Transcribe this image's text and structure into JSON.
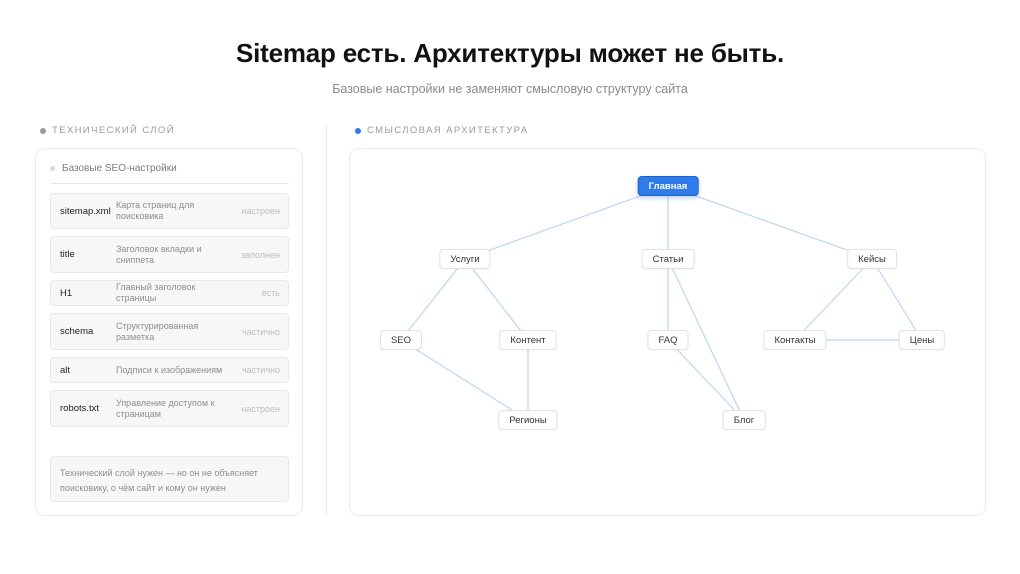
{
  "header": {
    "title": "Sitemap есть. Архитектуры может не быть.",
    "subtitle": "Базовые настройки не заменяют смысловую структуру сайта"
  },
  "left": {
    "section_label": "ТЕХНИЧЕСКИЙ СЛОЙ",
    "card_title": "Базовые SEO-настройки",
    "rows": [
      {
        "key": "sitemap.xml",
        "desc": "Карта страниц для поисковика",
        "status": "настроен"
      },
      {
        "key": "title",
        "desc": "Заголовок вкладки и сниппета",
        "status": "заполнен"
      },
      {
        "key": "H1",
        "desc": "Главный заголовок страницы",
        "status": "есть"
      },
      {
        "key": "schema",
        "desc": "Структурированная разметка",
        "status": "частично"
      },
      {
        "key": "alt",
        "desc": "Подписи к изображениям",
        "status": "частично"
      },
      {
        "key": "robots.txt",
        "desc": "Управление доступом к страницам",
        "status": "настроен"
      }
    ],
    "note": "Технический слой нужен — но он не объясняет поисковику, о чём сайт и кому он нужен"
  },
  "right": {
    "section_label": "СМЫСЛОВАЯ АРХИТЕКТУРА",
    "nodes": {
      "home": "Главная",
      "services": "Услуги",
      "articles": "Статьи",
      "cases": "Кейсы",
      "seo": "SEO",
      "content": "Контент",
      "faq": "FAQ",
      "contacts": "Контакты",
      "prices": "Цены",
      "regions": "Регионы",
      "blog": "Блог"
    },
    "edges": [
      [
        "home",
        "services"
      ],
      [
        "home",
        "articles"
      ],
      [
        "home",
        "cases"
      ],
      [
        "services",
        "seo"
      ],
      [
        "services",
        "content"
      ],
      [
        "articles",
        "faq"
      ],
      [
        "articles",
        "blog"
      ],
      [
        "cases",
        "contacts"
      ],
      [
        "cases",
        "prices"
      ],
      [
        "seo",
        "regions"
      ],
      [
        "content",
        "regions"
      ],
      [
        "faq",
        "blog"
      ],
      [
        "contacts",
        "prices"
      ]
    ]
  },
  "colors": {
    "accent": "#2f7be8",
    "edge": "#bcd6f3",
    "muted_text": "#8e8e8e"
  }
}
